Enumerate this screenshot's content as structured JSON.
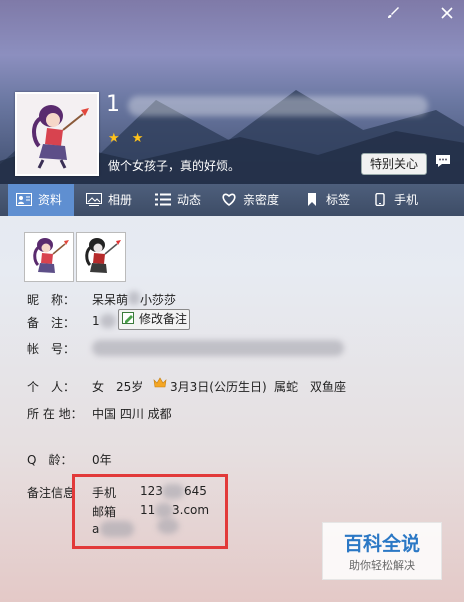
{
  "window": {
    "controls": {
      "skin": "brush-icon",
      "close": "close-icon"
    }
  },
  "profile": {
    "nickname_visible": "1",
    "stars": "★ ★",
    "signature": "做个女孩子，真的好烦。",
    "special_care": "特别关心"
  },
  "tabs": [
    {
      "label": "资料",
      "icon": "profile-card-icon"
    },
    {
      "label": "相册",
      "icon": "album-icon"
    },
    {
      "label": "动态",
      "icon": "feed-icon"
    },
    {
      "label": "亲密度",
      "icon": "heart-icon"
    },
    {
      "label": "标签",
      "icon": "bookmark-icon"
    },
    {
      "label": "手机",
      "icon": "phone-icon"
    }
  ],
  "info": {
    "nick_label": "昵　称：",
    "nick_value_a": "呆呆萌",
    "nick_value_b": "小莎莎",
    "remark_label": "备　注：",
    "remark_value": "1",
    "edit_remark": "修改备注",
    "account_label": "帐　号：",
    "person_label": "个　人：",
    "gender": "女",
    "age": "25岁",
    "birthday": "3月3日(公历生日)",
    "zodiac_cn": "属蛇",
    "zodiac": "双鱼座",
    "location_label": "所 在 地：",
    "location": "中国 四川 成都",
    "qage_label": "Q　龄：",
    "qage": "0年",
    "remark_info_label": "备注信息",
    "phone_label": "手机",
    "phone_a": "123",
    "phone_b": "645",
    "email_label": "邮箱",
    "email_a": "11",
    "email_b": "3.com",
    "third_line": "a"
  },
  "watermark": {
    "title": "百科全说",
    "subtitle": "助你轻松解决"
  },
  "colors": {
    "tab_active": "#5f8fd1",
    "star": "#ffc21a",
    "highlight_box": "#e23a3a"
  }
}
